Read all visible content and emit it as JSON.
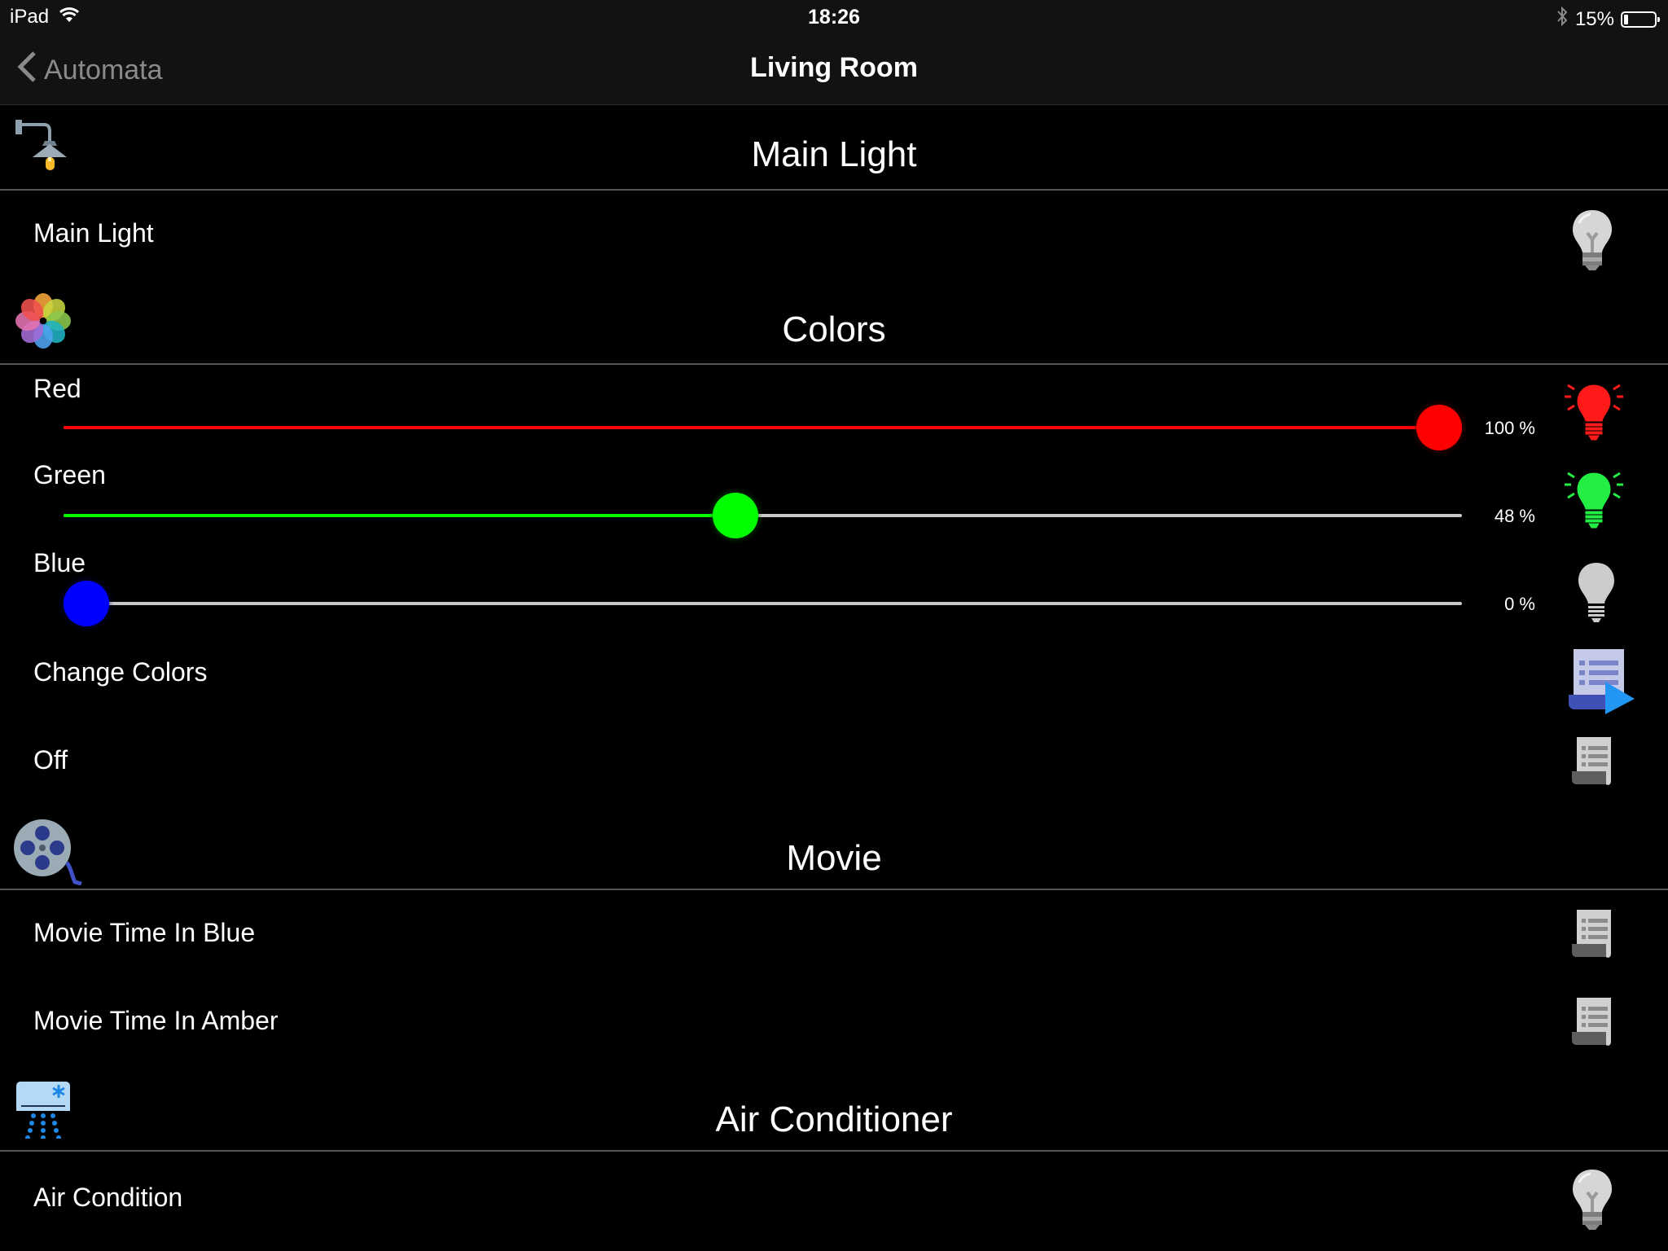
{
  "status_bar": {
    "device": "iPad",
    "time": "18:26",
    "battery_percent_label": "15%",
    "battery_level": 0.15,
    "icons": [
      "wifi-icon",
      "bluetooth-icon",
      "battery-icon"
    ]
  },
  "nav": {
    "back_label": "Automata",
    "title": "Living Room"
  },
  "sections": {
    "main_light": {
      "title": "Main Light",
      "icon": "wall-lamp-icon",
      "rows": [
        {
          "label": "Main Light",
          "icon": "lightbulb-off-icon",
          "state": "off"
        }
      ]
    },
    "colors": {
      "title": "Colors",
      "icon": "photos-flower-icon",
      "sliders": [
        {
          "label": "Red",
          "value": 100,
          "value_label": "100 %",
          "color": "#ff0000",
          "icon": "lightbulb-red-on-icon"
        },
        {
          "label": "Green",
          "value": 48,
          "value_label": "48 %",
          "color": "#00ff00",
          "icon": "lightbulb-green-on-icon"
        },
        {
          "label": "Blue",
          "value": 0,
          "value_label": "0 %",
          "color": "#0000ff",
          "icon": "lightbulb-off-icon"
        }
      ],
      "rows": [
        {
          "label": "Change Colors",
          "icon": "scene-running-icon"
        },
        {
          "label": "Off",
          "icon": "scene-icon"
        }
      ]
    },
    "movie": {
      "title": "Movie",
      "icon": "film-reel-icon",
      "rows": [
        {
          "label": "Movie Time In Blue",
          "icon": "scene-icon"
        },
        {
          "label": "Movie Time In Amber",
          "icon": "scene-icon"
        }
      ]
    },
    "air_conditioner": {
      "title": "Air Conditioner",
      "icon": "air-conditioner-icon",
      "rows": [
        {
          "label": "Air Condition",
          "icon": "lightbulb-off-icon",
          "state": "off"
        }
      ]
    }
  },
  "colors": {
    "track_inactive": "#c8c8c8",
    "divider": "#555555",
    "bar_background": "#121212",
    "back_label": "#8a8a8a"
  }
}
